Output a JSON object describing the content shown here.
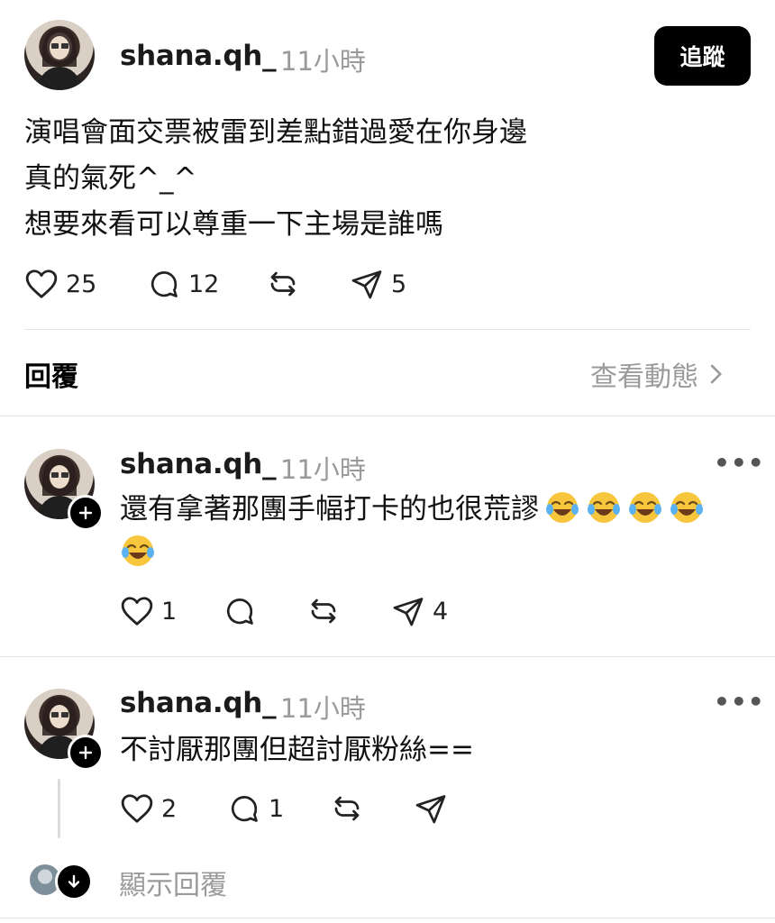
{
  "post": {
    "username": "shana.qh_",
    "time": "11小時",
    "follow_label": "追蹤",
    "lines": [
      "演唱會面交票被雷到差點錯過愛在你身邊",
      "真的氣死^_^",
      "想要來看可以尊重一下主場是誰嗎"
    ],
    "likes": "25",
    "comments": "12",
    "shares": "5"
  },
  "replies_header": {
    "title": "回覆",
    "view_activity": "查看動態"
  },
  "replies": [
    {
      "username": "shana.qh_",
      "time": "11小時",
      "text": "還有拿著那團手幅打卡的也很荒謬",
      "emoji_count": 5,
      "likes": "1",
      "comments": "",
      "shares": "4"
    },
    {
      "username": "shana.qh_",
      "time": "11小時",
      "text": "不討厭那團但超討厭粉絲==",
      "likes": "2",
      "comments": "1",
      "shares": ""
    }
  ],
  "show_replies_label": "顯示回覆",
  "icons": [
    "heart-icon",
    "comment-icon",
    "repost-icon",
    "share-icon",
    "more-icon",
    "plus-icon",
    "arrow-down-icon",
    "chevron-right-icon"
  ]
}
